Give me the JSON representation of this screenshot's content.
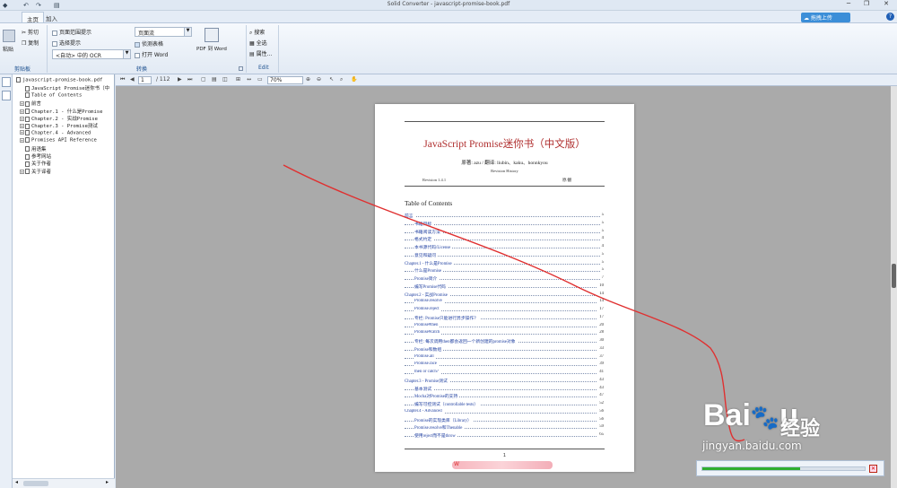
{
  "window": {
    "title": "Solid Converter - javascript-promise-book.pdf"
  },
  "quick_access": {
    "undo": "↶",
    "redo": "↷",
    "save": "▤"
  },
  "window_controls": {
    "minimize": "─",
    "restore": "❐",
    "close": "✕"
  },
  "tabs": [
    {
      "label": "主页"
    },
    {
      "label": "加入"
    }
  ],
  "upload": {
    "label": "拖拽上传"
  },
  "help": {
    "label": "?"
  },
  "ribbon": {
    "clipboard": {
      "label": "剪贴板",
      "paste": "粘贴",
      "cut": "剪切",
      "copy": "复制"
    },
    "options": {
      "page_range": "页面范围提示",
      "select": "选择提示",
      "ocr_value": "<自动> 中的 OCR"
    },
    "convert": {
      "label": "转换",
      "flow_value": "页面流",
      "detect_tables": "侦测表格",
      "open_word": "打开 Word",
      "pdf_to_word": "PDF 到 Word"
    },
    "edit": {
      "label": "Edit",
      "search": "搜索",
      "select_all": "全选",
      "properties": "属性..."
    }
  },
  "viewer_toolbar": {
    "current_page": "1",
    "total_pages": "/ 112",
    "zoom": "70%"
  },
  "tree": [
    {
      "label": "javascript-promise-book.pdf",
      "indent": 0,
      "expander": ""
    },
    {
      "label": "JavaScript Promise迷你书（中",
      "indent": 1,
      "expander": ""
    },
    {
      "label": "Table of Contents",
      "indent": 1,
      "expander": ""
    },
    {
      "label": "前言",
      "indent": 1,
      "expander": "+"
    },
    {
      "label": "Chapter.1 - 什么是Promise",
      "indent": 1,
      "expander": "+"
    },
    {
      "label": "Chapter.2 - 实战Promise",
      "indent": 1,
      "expander": "+"
    },
    {
      "label": "Chapter.3 - Promise测试",
      "indent": 1,
      "expander": "+"
    },
    {
      "label": "Chapter.4 - Advanced",
      "indent": 1,
      "expander": "+"
    },
    {
      "label": "Promises API Reference",
      "indent": 1,
      "expander": "+"
    },
    {
      "label": "用语集",
      "indent": 1,
      "expander": ""
    },
    {
      "label": "参考网站",
      "indent": 1,
      "expander": ""
    },
    {
      "label": "关于作者",
      "indent": 1,
      "expander": ""
    },
    {
      "label": "关于译者",
      "indent": 1,
      "expander": "+"
    }
  ],
  "pdf_page": {
    "title": "JavaScript Promise迷你书（中文版）",
    "authors": "原著: azu / 翻译: liubin、kaku、honnkyou",
    "revision_history": "Revision History",
    "revision": "Revision 1.4.1",
    "revision_note": "原/翻",
    "toc_heading": "Table of Contents",
    "page_number": "1",
    "toc": [
      {
        "text": "前言",
        "page": "5",
        "level": 0
      },
      {
        "text": "书籍目标",
        "page": "5",
        "level": 1
      },
      {
        "text": "书籍阅读方法",
        "page": "5",
        "level": 1
      },
      {
        "text": "格式约定",
        "page": "4",
        "level": 1
      },
      {
        "text": "本书源代码/License",
        "page": "4",
        "level": 1
      },
      {
        "text": "意见和疑问",
        "page": "5",
        "level": 1
      },
      {
        "text": "Chapter.1 - 什么是Promise",
        "page": "5",
        "level": 0
      },
      {
        "text": "什么是Promise",
        "page": "5",
        "level": 1
      },
      {
        "text": "Promise简介",
        "page": "7",
        "level": 1
      },
      {
        "text": "编写Promise代码",
        "page": "10",
        "level": 1
      },
      {
        "text": "Chapter.2 - 实战Promise",
        "page": "14",
        "level": 0
      },
      {
        "text": "Promise.resolve",
        "page": "14",
        "level": 1
      },
      {
        "text": "Promise.reject",
        "page": "17",
        "level": 1
      },
      {
        "text": "专栏: Promise只能进行异步操作？",
        "page": "17",
        "level": 1
      },
      {
        "text": "Promise#then",
        "page": "20",
        "level": 1
      },
      {
        "text": "Promise#catch",
        "page": "28",
        "level": 1
      },
      {
        "text": "专栏: 每次调用then都会返回一个新创建的promise对象",
        "page": "30",
        "level": 1
      },
      {
        "text": "Promise和数组",
        "page": "33",
        "level": 1
      },
      {
        "text": "Promise.all",
        "page": "37",
        "level": 1
      },
      {
        "text": "Promise.race",
        "page": "39",
        "level": 1
      },
      {
        "text": "then or catch?",
        "page": "41",
        "level": 1
      },
      {
        "text": "Chapter.3 - Promise测试",
        "page": "43",
        "level": 0
      },
      {
        "text": "基本测试",
        "page": "43",
        "level": 1
      },
      {
        "text": "Mocha对Promise的支持",
        "page": "47",
        "level": 1
      },
      {
        "text": "编写可控测试（controllable tests）",
        "page": "52",
        "level": 1
      },
      {
        "text": "Chapter.4 - Advanced",
        "page": "56",
        "level": 0
      },
      {
        "text": "Promise的实现类库（Library）",
        "page": "56",
        "level": 1
      },
      {
        "text": "Promise.resolve和Thenable",
        "page": "59",
        "level": 1
      },
      {
        "text": "使用reject而不是throw",
        "page": "65",
        "level": 1
      }
    ]
  },
  "watermark": {
    "logo": "Bai 经验",
    "url": "jingyan.baidu.com"
  },
  "progress": {
    "fraction": 0.6,
    "close": "✕"
  },
  "colors": {
    "accent": "#2f6fc0",
    "annotation": "#e03030",
    "title_red": "#b03030",
    "progress": "#2fae2f"
  }
}
